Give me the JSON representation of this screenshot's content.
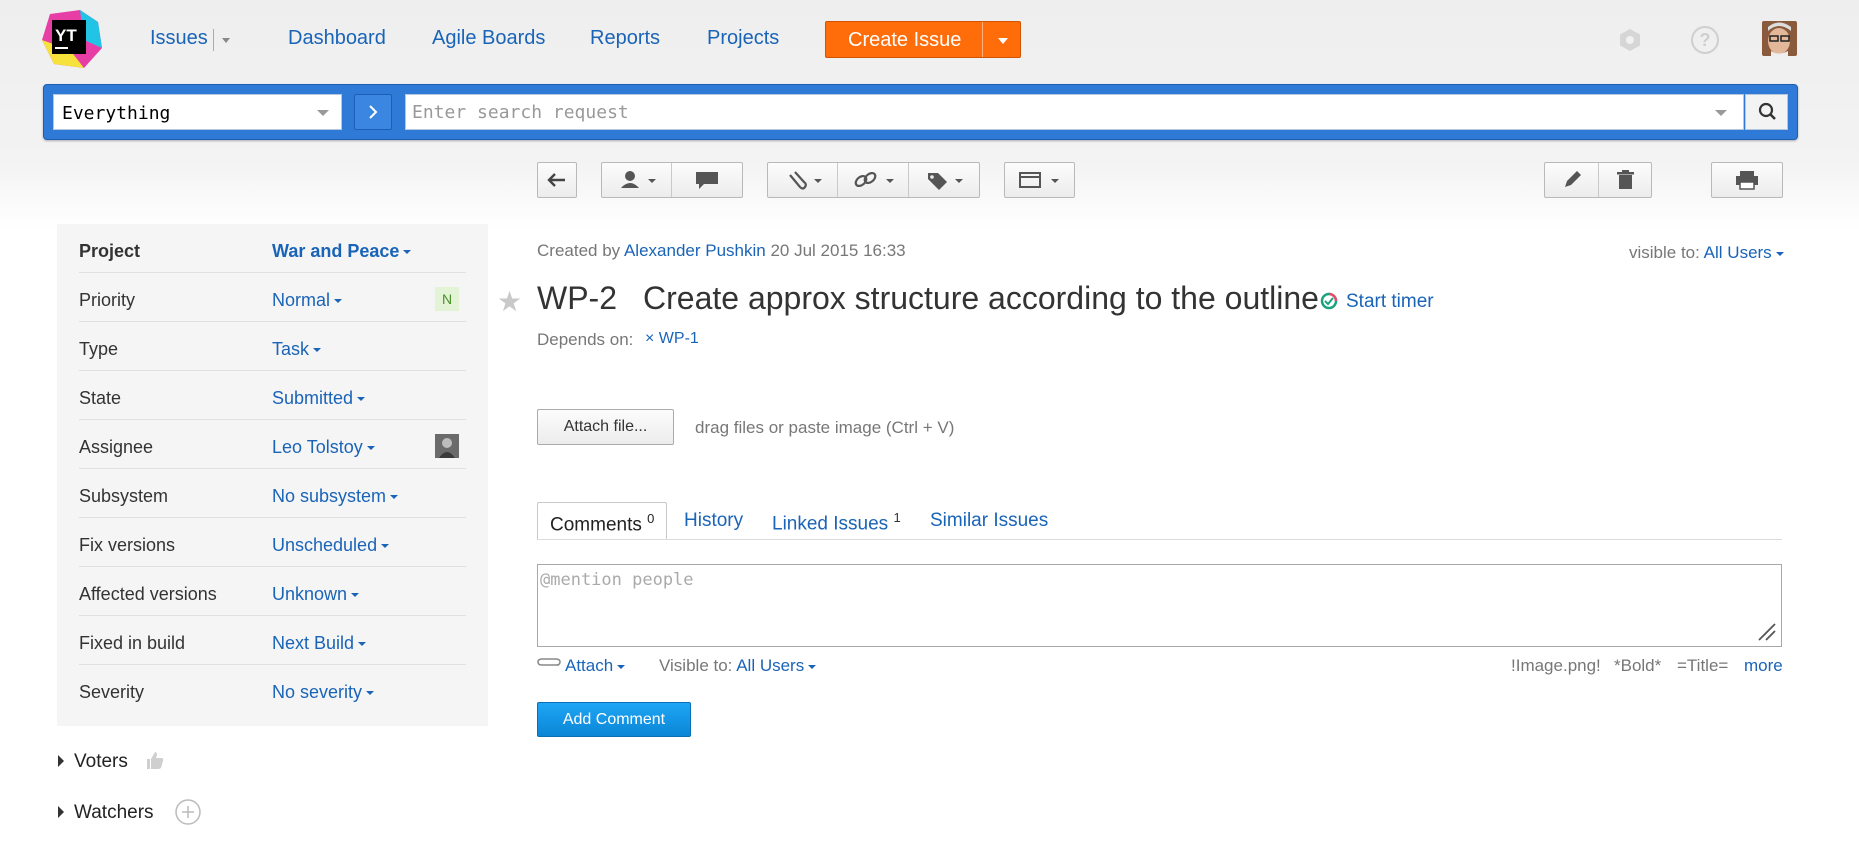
{
  "nav": {
    "logo_text": "YT",
    "issues": "Issues",
    "dashboard": "Dashboard",
    "agile_boards": "Agile Boards",
    "reports": "Reports",
    "projects": "Projects",
    "create_issue": "Create Issue"
  },
  "search": {
    "context": "Everything",
    "placeholder": "Enter search request"
  },
  "fields": [
    {
      "label": "Project",
      "value": "War and Peace"
    },
    {
      "label": "Priority",
      "value": "Normal",
      "badge": "N"
    },
    {
      "label": "Type",
      "value": "Task"
    },
    {
      "label": "State",
      "value": "Submitted"
    },
    {
      "label": "Assignee",
      "value": "Leo Tolstoy"
    },
    {
      "label": "Subsystem",
      "value": "No subsystem"
    },
    {
      "label": "Fix versions",
      "value": "Unscheduled"
    },
    {
      "label": "Affected versions",
      "value": "Unknown"
    },
    {
      "label": "Fixed in build",
      "value": "Next Build"
    },
    {
      "label": "Severity",
      "value": "No severity"
    }
  ],
  "side": {
    "voters": "Voters",
    "watchers": "Watchers"
  },
  "issue": {
    "created_by_label": "Created by",
    "author": "Alexander Pushkin",
    "created_at": "20 Jul 2015 16:33",
    "visible_to_label": "visible to:",
    "visible_to": "All Users",
    "id": "WP-2",
    "title": "Create approx structure according to the outline",
    "start_timer": "Start timer",
    "depends_label": "Depends on:",
    "depends_link": "× WP-1",
    "attach_file": "Attach file...",
    "drag_hint": "drag files or paste image (Ctrl + V)"
  },
  "tabs": [
    {
      "label": "Comments",
      "count": "0"
    },
    {
      "label": "History"
    },
    {
      "label": "Linked Issues",
      "count": "1"
    },
    {
      "label": "Similar Issues"
    }
  ],
  "comment": {
    "placeholder": "@mention people",
    "attach": "Attach",
    "visible_label": "Visible to:",
    "visible_value": "All Users",
    "hint_image": "!Image.png!",
    "hint_bold": "*Bold*",
    "hint_title": "=Title=",
    "more": "more",
    "add_comment": "Add Comment"
  },
  "colors": {
    "accent": "#1a64b8",
    "create": "#ff6c0a",
    "searchbar": "#2f7ad6",
    "add_comment": "#0b86d6"
  }
}
